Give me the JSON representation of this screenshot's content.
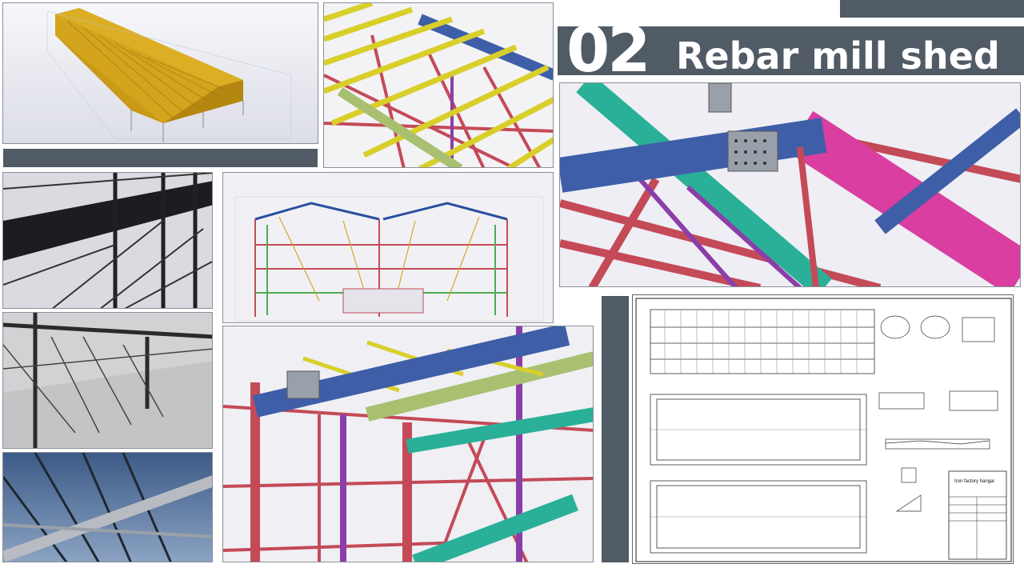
{
  "slide": {
    "section_number": "02",
    "section_title": "Rebar mill shed",
    "accent_color": "#505b66"
  },
  "images": [
    {
      "name": "full-roof-model"
    },
    {
      "name": "roof-purlins-closeup"
    },
    {
      "name": "beam-splice-detail"
    },
    {
      "name": "dark-render-interior"
    },
    {
      "name": "grey-render-interior"
    },
    {
      "name": "sky-render-roof"
    },
    {
      "name": "double-span-frame-model"
    },
    {
      "name": "colored-interior-perspective"
    },
    {
      "name": "technical-drawing-sheet"
    }
  ],
  "drawing": {
    "title_block_line1": "Iron factory hangar"
  }
}
